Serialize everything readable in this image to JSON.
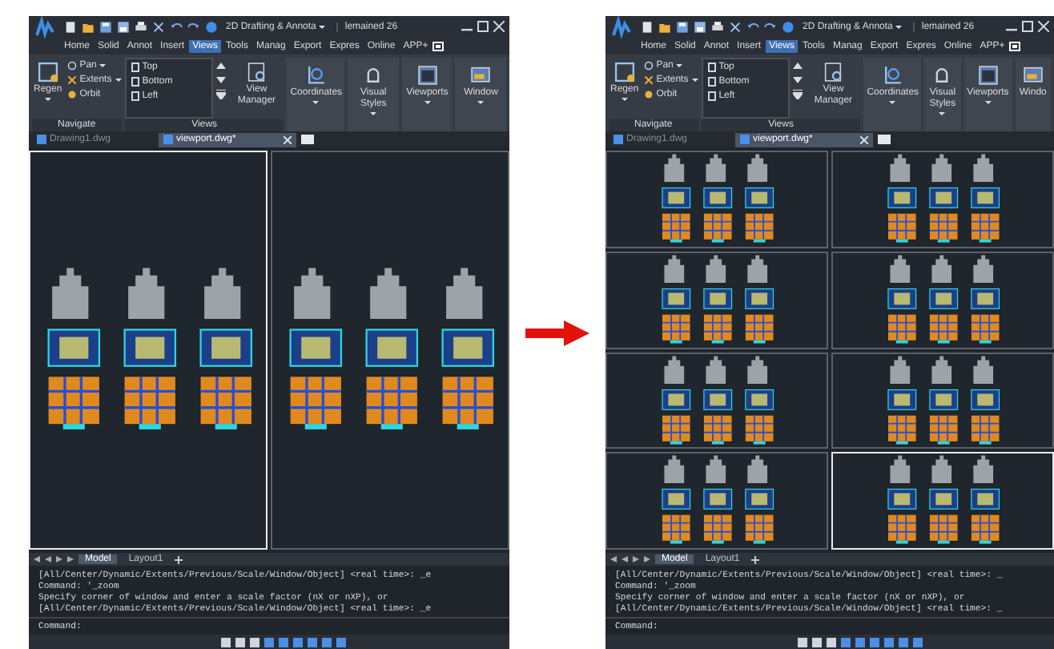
{
  "panels": [
    {
      "workspace": "2D Drafting & Annota",
      "user_text": "lemained 26",
      "menu": [
        {
          "label": "Home",
          "selected": false
        },
        {
          "label": "Solid",
          "selected": false
        },
        {
          "label": "Annot",
          "selected": false
        },
        {
          "label": "Insert",
          "selected": false
        },
        {
          "label": "Views",
          "selected": true
        },
        {
          "label": "Tools",
          "selected": false
        },
        {
          "label": "Manag",
          "selected": false
        },
        {
          "label": "Export",
          "selected": false
        },
        {
          "label": "Expres",
          "selected": false
        },
        {
          "label": "Online",
          "selected": false
        },
        {
          "label": "APP+",
          "selected": false
        }
      ],
      "ribbon": {
        "regen": "Regen",
        "nav_items": [
          {
            "label": "Pan",
            "dropdown": true
          },
          {
            "label": "Extents",
            "dropdown": true
          },
          {
            "label": "Orbit",
            "dropdown": false
          }
        ],
        "views": [
          "Top",
          "Bottom",
          "Left"
        ],
        "view_manager": "View Manager",
        "tools": [
          {
            "label": "Coordinates",
            "dropdown": true
          },
          {
            "label": "Visual Styles",
            "dropdown": true
          },
          {
            "label": "Viewports",
            "dropdown": true
          },
          {
            "label": "Window",
            "dropdown": true
          }
        ],
        "groups": [
          "Navigate",
          "Views"
        ]
      },
      "doc_tabs": [
        {
          "label": "Drawing1.dwg",
          "selected": false
        },
        {
          "label": "viewport.dwg*",
          "selected": true
        }
      ],
      "viewport_rows": [
        {
          "cells": [
            {
              "selected": true
            },
            {
              "selected": false
            }
          ]
        }
      ],
      "layout_tabs": [
        {
          "label": "Model",
          "selected": true
        },
        {
          "label": "Layout1",
          "selected": false
        }
      ],
      "command": {
        "history": [
          "[All/Center/Dynamic/Extents/Previous/Scale/Window/Object] <real time>: _e",
          "Command: '_zoom",
          "Specify corner of window and enter a scale factor (nX or nXP), or",
          "[All/Center/Dynamic/Extents/Previous/Scale/Window/Object] <real time>: _e"
        ],
        "prompt": "Command:"
      }
    },
    {
      "workspace": "2D Drafting & Annota",
      "user_text": "lemained 26",
      "menu": [
        {
          "label": "Home",
          "selected": false
        },
        {
          "label": "Solid",
          "selected": false
        },
        {
          "label": "Annot",
          "selected": false
        },
        {
          "label": "Insert",
          "selected": false
        },
        {
          "label": "Views",
          "selected": true
        },
        {
          "label": "Tools",
          "selected": false
        },
        {
          "label": "Manag",
          "selected": false
        },
        {
          "label": "Export",
          "selected": false
        },
        {
          "label": "Expres",
          "selected": false
        },
        {
          "label": "Online",
          "selected": false
        },
        {
          "label": "APP+",
          "selected": false
        }
      ],
      "ribbon": {
        "regen": "Regen",
        "nav_items": [
          {
            "label": "Pan",
            "dropdown": true
          },
          {
            "label": "Extents",
            "dropdown": true
          },
          {
            "label": "Orbit",
            "dropdown": false
          }
        ],
        "views": [
          "Top",
          "Bottom",
          "Left"
        ],
        "view_manager": "View Manager",
        "tools": [
          {
            "label": "Coordinates",
            "dropdown": true
          },
          {
            "label": "Visual Styles",
            "dropdown": true
          },
          {
            "label": "Viewports",
            "dropdown": true
          },
          {
            "label": "Windo",
            "dropdown": false
          }
        ],
        "groups": [
          "Navigate",
          "Views"
        ]
      },
      "doc_tabs": [
        {
          "label": "Drawing1.dwg",
          "selected": false
        },
        {
          "label": "viewport.dwg*",
          "selected": true
        }
      ],
      "viewport_rows": [
        {
          "cells": [
            {
              "selected": false
            },
            {
              "selected": false
            }
          ]
        },
        {
          "cells": [
            {
              "selected": false
            },
            {
              "selected": false
            }
          ]
        },
        {
          "cells": [
            {
              "selected": false
            },
            {
              "selected": false
            }
          ]
        },
        {
          "cells": [
            {
              "selected": false
            },
            {
              "selected": true
            }
          ]
        }
      ],
      "layout_tabs": [
        {
          "label": "Model",
          "selected": true
        },
        {
          "label": "Layout1",
          "selected": false
        }
      ],
      "command": {
        "history": [
          "[All/Center/Dynamic/Extents/Previous/Scale/Window/Object] <real time>: _",
          "Command: '_zoom",
          "Specify corner of window and enter a scale factor (nX or nXP), or",
          "[All/Center/Dynamic/Extents/Previous/Scale/Window/Object] <real time>: _"
        ],
        "prompt": "Command:"
      }
    }
  ]
}
